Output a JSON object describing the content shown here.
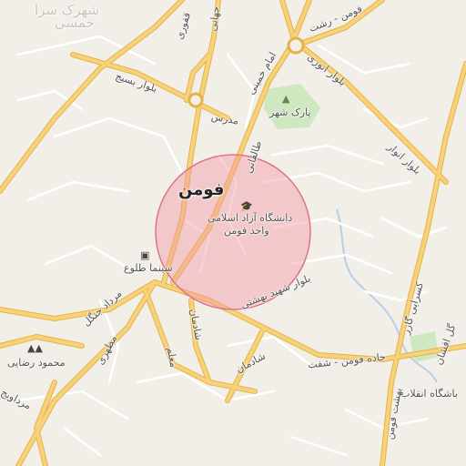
{
  "map": {
    "city_name": "فومن",
    "labels": {
      "university_line1": "دانشگاه آزاد اسلامی",
      "university_line2": "واحد فومن",
      "park": "پارک شهر",
      "cinema": "سینما طلوع",
      "imam_rezaei": "محمود رضایی",
      "club": "باشگاه انقلاب",
      "faint_top": "شهرک سرا",
      "faint_top2": "خمسی",
      "blvd_basij": "بلوار بسیج",
      "madres": "مدرس",
      "blvd_anvari": "بلوار انوری",
      "blvd_anvari2": "بلوار انوار",
      "emam": "امام خمینی",
      "rasht": "فومن - رشت",
      "qafouri": "قفوری",
      "jahani": "جهانی",
      "talegani": "طالقانی",
      "mardad_jangal": "مرداد جنگل",
      "blvd_shahid": "بلوار شهید بهشتی",
      "fuman_shaft": "جاده فومن - شفت",
      "shadman": "شادمان",
      "shadman2": "شادمان",
      "gil": "گل افشان",
      "kasrai": "کسرایی گازر",
      "behesht_fuman": "بهشت فومن",
      "motahari": "مطهری",
      "mardavij": "مرداویج",
      "moallem": "معلم"
    },
    "colors": {
      "background": "#f2efe9",
      "major_road": "#f7d27a",
      "major_road_edge": "#e3b34a",
      "minor_road": "#ffffff",
      "park": "#cfe8c0",
      "circle_fill": "#f29aa5",
      "circle_stroke": "#e07484",
      "river": "#b6d0e8"
    },
    "icons": [
      "university-icon",
      "tree-icon",
      "cinema-icon",
      "mosque-icon"
    ]
  }
}
